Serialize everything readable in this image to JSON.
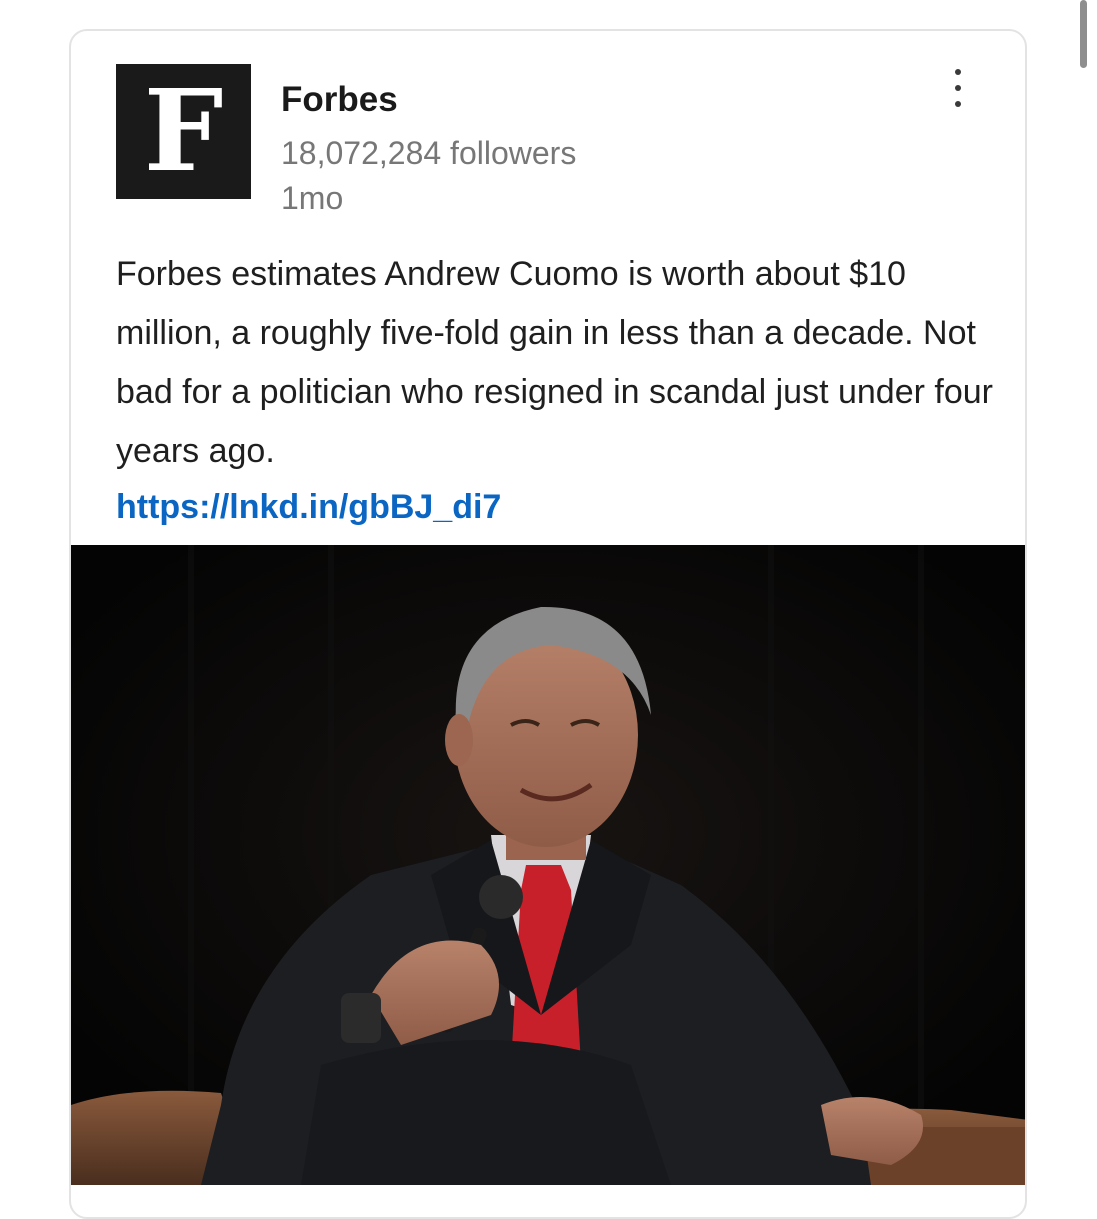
{
  "post": {
    "author": {
      "logo_letter": "F",
      "name": "Forbes",
      "followers": "18,072,284 followers",
      "time": "1mo"
    },
    "text": "Forbes estimates Andrew Cuomo is worth about $10 million, a roughly five-fold gain in less than a decade. Not bad for a politician who resigned in scandal just under four years ago.",
    "link": "https://lnkd.in/gbBJ_di7",
    "icons": {
      "menu": "more-vertical-icon"
    }
  },
  "colors": {
    "link": "#0a66c2",
    "tie": "#c8202a"
  }
}
